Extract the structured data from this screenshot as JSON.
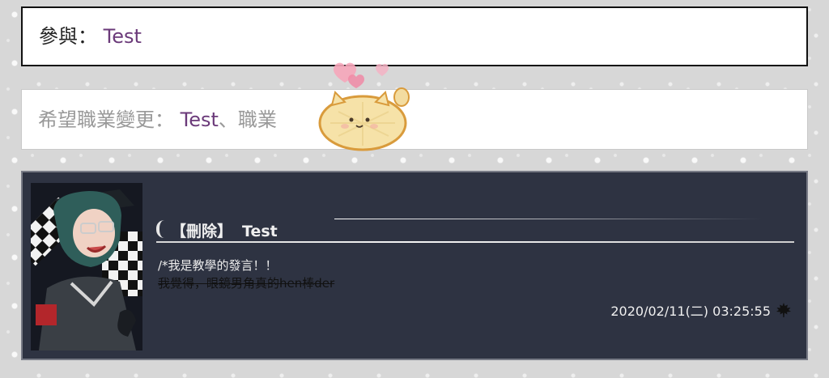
{
  "participate": {
    "label": "參與：",
    "value": "Test"
  },
  "job_change": {
    "label": "希望職業變更：",
    "value": "Test",
    "separator": "、",
    "extra": "職業"
  },
  "post": {
    "delete_label": "【刪除】",
    "author": "Test",
    "line1": "/*我是教學的發言！！",
    "line2_struck": "我覺得，眼鏡男角真的hen棒der",
    "timestamp": "2020/02/11(二) 03:25:55"
  },
  "icons": {
    "mascot": "melonpan-cat-sticker",
    "hearts": "pink-hearts",
    "leaf": "maple-leaf-icon"
  },
  "colors": {
    "value_purple": "#6b3a7a",
    "post_bg": "#2e3342",
    "label_gray": "#999999"
  }
}
